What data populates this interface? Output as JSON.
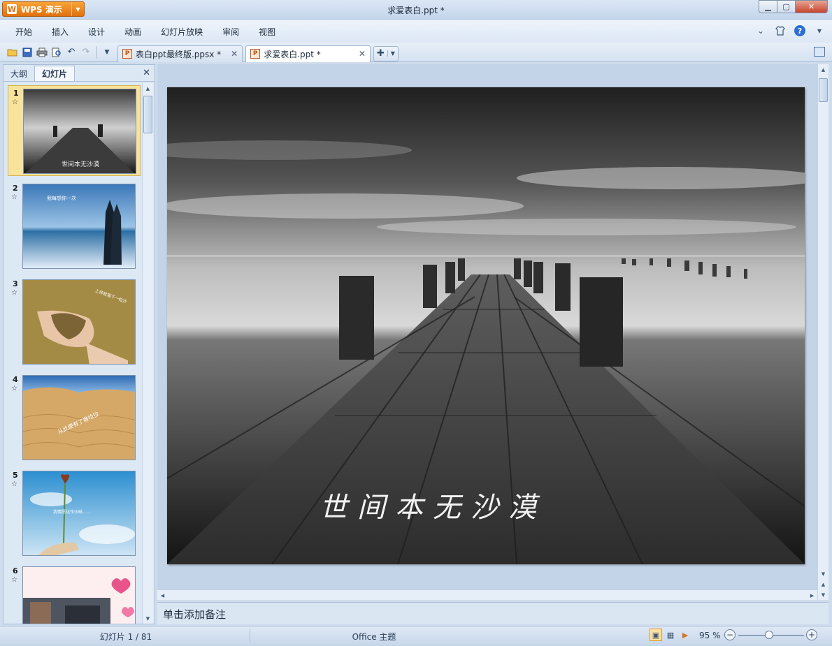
{
  "app": {
    "name": "WPS 演示",
    "window_title": "求爱表白.ppt *"
  },
  "menu": [
    "开始",
    "插入",
    "设计",
    "动画",
    "幻灯片放映",
    "审阅",
    "视图"
  ],
  "toolbar": {
    "icons": [
      "open-folder-icon",
      "save-icon",
      "print-icon",
      "print-preview-icon",
      "undo-icon",
      "redo-icon",
      "customize-dropdown-icon"
    ]
  },
  "doc_tabs": [
    {
      "label": "表白ppt最终版.ppsx *",
      "active": false
    },
    {
      "label": "求爱表白.ppt *",
      "active": true
    }
  ],
  "left_panel": {
    "tabs": [
      "大纲",
      "幻灯片"
    ],
    "active_tab": "幻灯片",
    "thumbnails": [
      {
        "number": "1",
        "star": "☆",
        "caption": "世间本无沙漠",
        "selected": true
      },
      {
        "number": "2",
        "star": "☆",
        "caption": "我每想你一次",
        "selected": false
      },
      {
        "number": "3",
        "star": "☆",
        "caption": "上帝就落下一粒沙",
        "selected": false
      },
      {
        "number": "4",
        "star": "☆",
        "caption": "从此便有了撒哈拉",
        "selected": false
      },
      {
        "number": "5",
        "star": "☆",
        "caption": "我情愿化作沙砾……",
        "selected": false
      },
      {
        "number": "6",
        "star": "☆",
        "caption": "",
        "selected": false
      }
    ]
  },
  "slide": {
    "caption": "世间本无沙漠"
  },
  "notes": {
    "placeholder": "单击添加备注"
  },
  "status": {
    "slide_counter": "幻灯片 1 / 81",
    "theme": "Office 主题",
    "zoom": "95 %"
  },
  "colors": {
    "wps_orange": "#e7760f",
    "panel_bg": "#dde8f5",
    "selected_thumb": "#f8e39a"
  }
}
